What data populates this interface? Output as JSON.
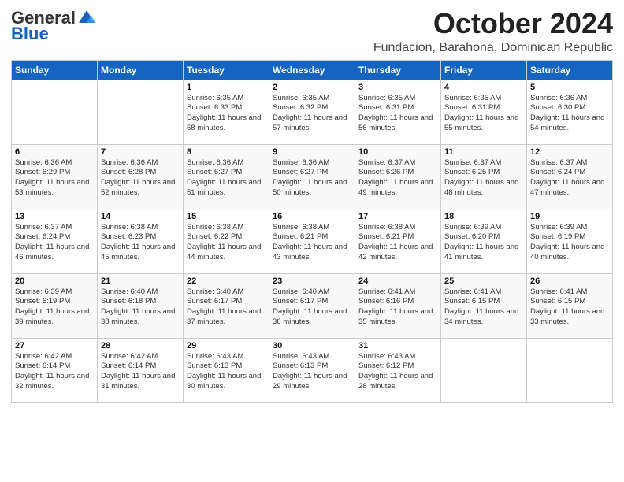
{
  "logo": {
    "general": "General",
    "blue": "Blue"
  },
  "title": "October 2024",
  "subtitle": "Fundacion, Barahona, Dominican Republic",
  "days_of_week": [
    "Sunday",
    "Monday",
    "Tuesday",
    "Wednesday",
    "Thursday",
    "Friday",
    "Saturday"
  ],
  "weeks": [
    [
      {
        "day": "",
        "info": ""
      },
      {
        "day": "",
        "info": ""
      },
      {
        "day": "1",
        "info": "Sunrise: 6:35 AM\nSunset: 6:33 PM\nDaylight: 11 hours and 58 minutes."
      },
      {
        "day": "2",
        "info": "Sunrise: 6:35 AM\nSunset: 6:32 PM\nDaylight: 11 hours and 57 minutes."
      },
      {
        "day": "3",
        "info": "Sunrise: 6:35 AM\nSunset: 6:31 PM\nDaylight: 11 hours and 56 minutes."
      },
      {
        "day": "4",
        "info": "Sunrise: 6:35 AM\nSunset: 6:31 PM\nDaylight: 11 hours and 55 minutes."
      },
      {
        "day": "5",
        "info": "Sunrise: 6:36 AM\nSunset: 6:30 PM\nDaylight: 11 hours and 54 minutes."
      }
    ],
    [
      {
        "day": "6",
        "info": "Sunrise: 6:36 AM\nSunset: 6:29 PM\nDaylight: 11 hours and 53 minutes."
      },
      {
        "day": "7",
        "info": "Sunrise: 6:36 AM\nSunset: 6:28 PM\nDaylight: 11 hours and 52 minutes."
      },
      {
        "day": "8",
        "info": "Sunrise: 6:36 AM\nSunset: 6:27 PM\nDaylight: 11 hours and 51 minutes."
      },
      {
        "day": "9",
        "info": "Sunrise: 6:36 AM\nSunset: 6:27 PM\nDaylight: 11 hours and 50 minutes."
      },
      {
        "day": "10",
        "info": "Sunrise: 6:37 AM\nSunset: 6:26 PM\nDaylight: 11 hours and 49 minutes."
      },
      {
        "day": "11",
        "info": "Sunrise: 6:37 AM\nSunset: 6:25 PM\nDaylight: 11 hours and 48 minutes."
      },
      {
        "day": "12",
        "info": "Sunrise: 6:37 AM\nSunset: 6:24 PM\nDaylight: 11 hours and 47 minutes."
      }
    ],
    [
      {
        "day": "13",
        "info": "Sunrise: 6:37 AM\nSunset: 6:24 PM\nDaylight: 11 hours and 46 minutes."
      },
      {
        "day": "14",
        "info": "Sunrise: 6:38 AM\nSunset: 6:23 PM\nDaylight: 11 hours and 45 minutes."
      },
      {
        "day": "15",
        "info": "Sunrise: 6:38 AM\nSunset: 6:22 PM\nDaylight: 11 hours and 44 minutes."
      },
      {
        "day": "16",
        "info": "Sunrise: 6:38 AM\nSunset: 6:21 PM\nDaylight: 11 hours and 43 minutes."
      },
      {
        "day": "17",
        "info": "Sunrise: 6:38 AM\nSunset: 6:21 PM\nDaylight: 11 hours and 42 minutes."
      },
      {
        "day": "18",
        "info": "Sunrise: 6:39 AM\nSunset: 6:20 PM\nDaylight: 11 hours and 41 minutes."
      },
      {
        "day": "19",
        "info": "Sunrise: 6:39 AM\nSunset: 6:19 PM\nDaylight: 11 hours and 40 minutes."
      }
    ],
    [
      {
        "day": "20",
        "info": "Sunrise: 6:39 AM\nSunset: 6:19 PM\nDaylight: 11 hours and 39 minutes."
      },
      {
        "day": "21",
        "info": "Sunrise: 6:40 AM\nSunset: 6:18 PM\nDaylight: 11 hours and 38 minutes."
      },
      {
        "day": "22",
        "info": "Sunrise: 6:40 AM\nSunset: 6:17 PM\nDaylight: 11 hours and 37 minutes."
      },
      {
        "day": "23",
        "info": "Sunrise: 6:40 AM\nSunset: 6:17 PM\nDaylight: 11 hours and 36 minutes."
      },
      {
        "day": "24",
        "info": "Sunrise: 6:41 AM\nSunset: 6:16 PM\nDaylight: 11 hours and 35 minutes."
      },
      {
        "day": "25",
        "info": "Sunrise: 6:41 AM\nSunset: 6:15 PM\nDaylight: 11 hours and 34 minutes."
      },
      {
        "day": "26",
        "info": "Sunrise: 6:41 AM\nSunset: 6:15 PM\nDaylight: 11 hours and 33 minutes."
      }
    ],
    [
      {
        "day": "27",
        "info": "Sunrise: 6:42 AM\nSunset: 6:14 PM\nDaylight: 11 hours and 32 minutes."
      },
      {
        "day": "28",
        "info": "Sunrise: 6:42 AM\nSunset: 6:14 PM\nDaylight: 11 hours and 31 minutes."
      },
      {
        "day": "29",
        "info": "Sunrise: 6:43 AM\nSunset: 6:13 PM\nDaylight: 11 hours and 30 minutes."
      },
      {
        "day": "30",
        "info": "Sunrise: 6:43 AM\nSunset: 6:13 PM\nDaylight: 11 hours and 29 minutes."
      },
      {
        "day": "31",
        "info": "Sunrise: 6:43 AM\nSunset: 6:12 PM\nDaylight: 11 hours and 28 minutes."
      },
      {
        "day": "",
        "info": ""
      },
      {
        "day": "",
        "info": ""
      }
    ]
  ]
}
